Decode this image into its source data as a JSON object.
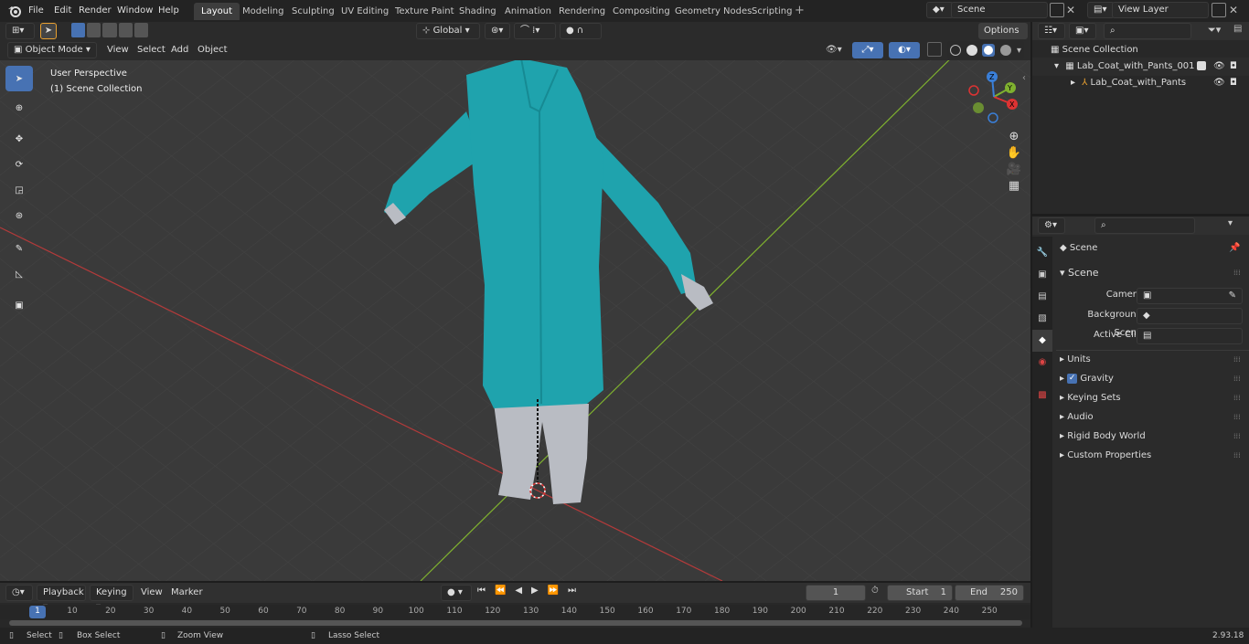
{
  "menus": [
    "File",
    "Edit",
    "Render",
    "Window",
    "Help"
  ],
  "workspaces": [
    "Layout",
    "Modeling",
    "Sculpting",
    "UV Editing",
    "Texture Paint",
    "Shading",
    "Animation",
    "Rendering",
    "Compositing",
    "Geometry Nodes",
    "Scripting"
  ],
  "active_workspace": "Layout",
  "scene_field": "Scene",
  "viewlayer_field": "View Layer",
  "viewport": {
    "mode": "Object Mode",
    "menus": [
      "View",
      "Select",
      "Add",
      "Object"
    ],
    "transform": "Global",
    "options": "Options",
    "overlay_title": "User Perspective",
    "overlay_sub": "(1) Scene Collection",
    "gizmo": {
      "x": "X",
      "y": "Y",
      "z": "Z"
    }
  },
  "outliner": {
    "root": "Scene Collection",
    "items": [
      "Lab_Coat_with_Pants_001",
      "Lab_Coat_with_Pants"
    ]
  },
  "properties": {
    "context": "Scene",
    "panel": "Scene",
    "fields": [
      {
        "label": "Camera"
      },
      {
        "label": "Background Scene"
      },
      {
        "label": "Active Clip"
      }
    ],
    "sections": [
      "Units",
      "Gravity",
      "Keying Sets",
      "Audio",
      "Rigid Body World",
      "Custom Properties"
    ],
    "gravity_checked": true
  },
  "timeline": {
    "menus": [
      "Playback",
      "Keying",
      "View",
      "Marker"
    ],
    "current": "1",
    "start_label": "Start",
    "start": "1",
    "end_label": "End",
    "end": "250",
    "ticks": [
      "1",
      "10",
      "20",
      "30",
      "40",
      "50",
      "60",
      "70",
      "80",
      "90",
      "100",
      "110",
      "120",
      "130",
      "140",
      "150",
      "160",
      "170",
      "180",
      "190",
      "200",
      "210",
      "220",
      "230",
      "240",
      "250"
    ]
  },
  "statusbar": {
    "select": "Select",
    "box": "Box Select",
    "zoom": "Zoom View",
    "lasso": "Lasso Select",
    "version": "2.93.18"
  },
  "colors": {
    "accent": "#4772b3",
    "coat": "#1fa3ad",
    "pants": "#b9bcc3",
    "xaxis": "#b33a3a",
    "yaxis": "#7fb12f"
  }
}
